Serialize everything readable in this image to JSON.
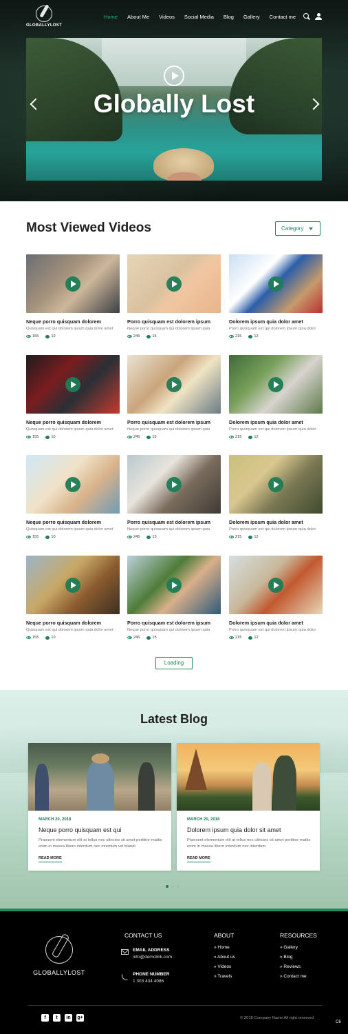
{
  "brand": {
    "name": "GLOBALLYLOST"
  },
  "nav": {
    "items": [
      "Home",
      "About Me",
      "Videos",
      "Social Media",
      "Blog",
      "Gallery",
      "Contact me"
    ],
    "active": "Home",
    "icons": [
      "search-icon",
      "user-icon"
    ]
  },
  "hero": {
    "title": "Globally Lost"
  },
  "videos": {
    "title": "Most Viewed Videos",
    "category_label": "Category",
    "items": [
      {
        "title": "Neque porro quisquam dolorem",
        "desc": "Quisquam est qui dolorem ipsum quia dolor amet",
        "views": "155",
        "comments": "10"
      },
      {
        "title": "Porro quisquam est dolorem ipsum",
        "desc": "Neque porro quisquam qui dolorem ipsum quia",
        "views": "245",
        "comments": "15"
      },
      {
        "title": "Dolorem ipsum quia dolor amet",
        "desc": "Porro quisquam est qui dolorem ipsum quia dolor",
        "views": "215",
        "comments": "12"
      },
      {
        "title": "Neque porro quisquam dolorem",
        "desc": "Quisquam est qui dolorem ipsum quia dolor amet",
        "views": "155",
        "comments": "10"
      },
      {
        "title": "Porro quisquam est dolorem ipsum",
        "desc": "Neque porro quisquam qui dolorem ipsum quia",
        "views": "245",
        "comments": "15"
      },
      {
        "title": "Dolorem ipsum quia dolor amet",
        "desc": "Porro quisquam est qui dolorem ipsum quia dolor",
        "views": "215",
        "comments": "12"
      },
      {
        "title": "Neque porro quisquam dolorem",
        "desc": "Quisquam est qui dolorem ipsum quia dolor amet",
        "views": "155",
        "comments": "10"
      },
      {
        "title": "Porro quisquam est dolorem ipsum",
        "desc": "Neque porro quisquam qui dolorem ipsum quia",
        "views": "245",
        "comments": "15"
      },
      {
        "title": "Dolorem ipsum quia dolor amet",
        "desc": "Porro quisquam est qui dolorem ipsum quia dolor",
        "views": "215",
        "comments": "12"
      },
      {
        "title": "Neque porro quisquam dolorem",
        "desc": "Quisquam est qui dolorem ipsum quia dolor amet",
        "views": "155",
        "comments": "10"
      },
      {
        "title": "Porro quisquam est dolorem ipsum",
        "desc": "Neque porro quisquam qui dolorem ipsum quia",
        "views": "245",
        "comments": "15"
      },
      {
        "title": "Dolorem ipsum quia dolor amet",
        "desc": "Porro quisquam est qui dolorem ipsum quia dolor",
        "views": "215",
        "comments": "12"
      }
    ],
    "load_label": "Loading"
  },
  "blog": {
    "title": "Latest Blog",
    "posts": [
      {
        "date": "MARCH 20, 2018",
        "title": "Neque porro quisquam est qui",
        "desc": "Praesent elementum elit at tellus nec ultricies sit amet porttitor mattis enim in massa libero interdum nec interdum vel blandi",
        "more": "READ MORE"
      },
      {
        "date": "MARCH 20, 2018",
        "title": "Dolorem ipsum quia dolor sit amet",
        "desc": "Praesent elementum elit at tellus nec ultricies sit amet porttitor mattis enim in massa libero interdum nec interdum",
        "more": "READ MORE"
      }
    ]
  },
  "footer": {
    "contact_heading": "CONTACT US",
    "email_label": "EMAIL ADDRESS",
    "email": "info@demolink.com",
    "phone_label": "PHONE NUMBER",
    "phone": "1 303 434 4086",
    "about_heading": "ABOUT",
    "about_links": [
      "» Home",
      "» About us",
      "» Videos",
      "» Travels"
    ],
    "resources_heading": "RESOURCES",
    "resources_links": [
      "» Gallery",
      "» Blog",
      "» Reviews",
      "» Contact me"
    ],
    "social": [
      "facebook-icon",
      "twitter-icon",
      "linkedin-icon",
      "google-plus-icon"
    ],
    "copyright": "© 2018 Company Name  All right reserved",
    "badge": "C6"
  },
  "colors": {
    "accent": "#1e8a5e",
    "nav_active": "#27b37c",
    "footer_bg": "#000000"
  }
}
